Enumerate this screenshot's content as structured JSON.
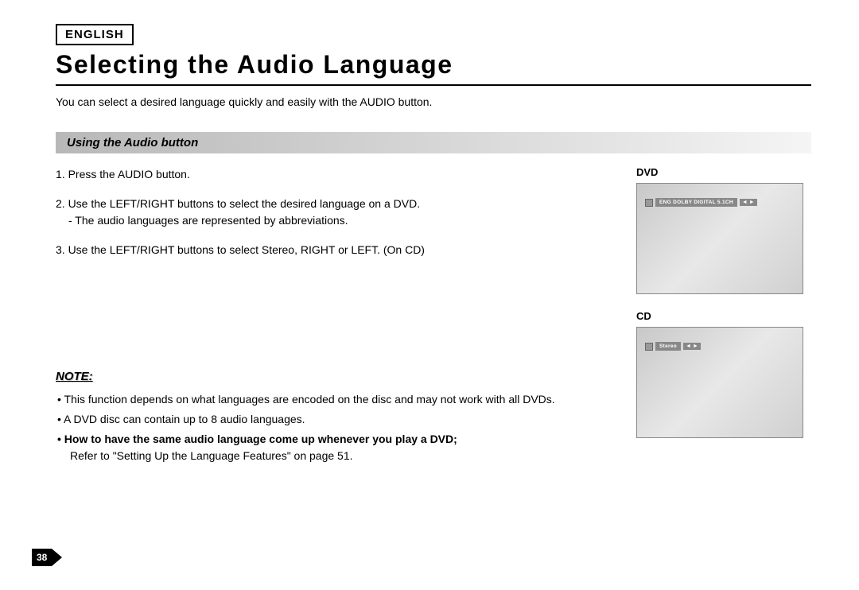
{
  "header": {
    "language_badge": "ENGLISH",
    "title": "Selecting the Audio Language",
    "intro": "You can select a desired language quickly and easily with the AUDIO button."
  },
  "section": {
    "heading": "Using the Audio button",
    "steps": {
      "s1": "1. Press the AUDIO button.",
      "s2": "2. Use the LEFT/RIGHT buttons to select the desired language on a DVD.",
      "s2_sub": "- The audio languages are represented by abbreviations.",
      "s3": "3. Use the LEFT/RIGHT buttons to select Stereo, RIGHT or LEFT. (On CD)"
    }
  },
  "screens": {
    "dvd": {
      "label": "DVD",
      "osd": "ENG DOLBY DIGITAL 5.1CH"
    },
    "cd": {
      "label": "CD",
      "osd": "Stereo"
    }
  },
  "note": {
    "heading": "NOTE:",
    "n1": "• This function depends on what languages are encoded on the disc and may not work with all DVDs.",
    "n2": "• A DVD disc can contain up to 8 audio languages.",
    "n3_bold": "• How to have the same audio language come up whenever you play a DVD;",
    "n3_rest": "Refer to \"Setting Up the Language Features\" on page 51."
  },
  "page_number": "38"
}
